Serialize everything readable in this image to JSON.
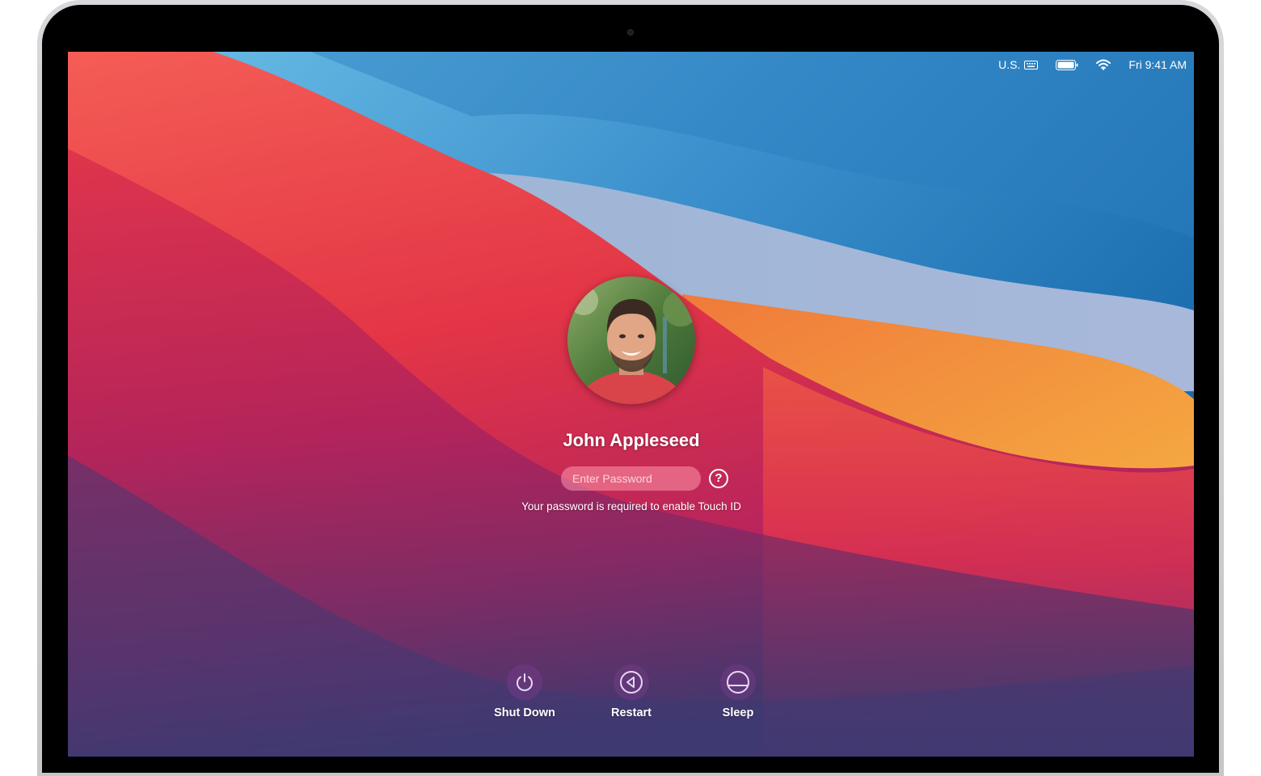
{
  "menubar": {
    "input_source": "U.S.",
    "keyboard_icon": "keyboard-icon",
    "battery_icon": "battery-icon",
    "wifi_icon": "wifi-icon",
    "clock": "Fri 9:41 AM"
  },
  "login": {
    "user_name": "John Appleseed",
    "password_placeholder": "Enter Password",
    "password_value": "",
    "help_label": "?",
    "hint": "Your password is required to enable Touch ID"
  },
  "actions": [
    {
      "label": "Shut Down",
      "icon": "power-icon"
    },
    {
      "label": "Restart",
      "icon": "restart-icon"
    },
    {
      "label": "Sleep",
      "icon": "sleep-icon"
    }
  ],
  "colors": {
    "accent_field": "#ff96aa",
    "action_circle": "#783c8c"
  }
}
